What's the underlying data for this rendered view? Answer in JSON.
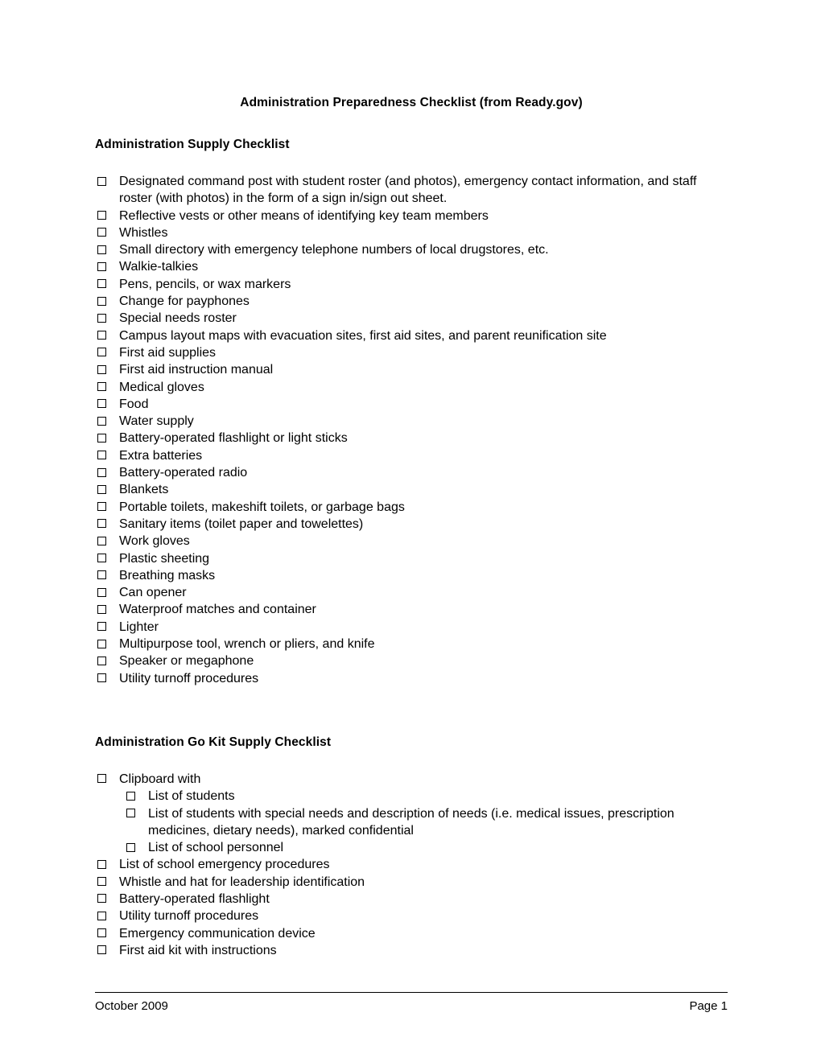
{
  "document": {
    "title": "Administration Preparedness Checklist (from Ready.gov)"
  },
  "sections": [
    {
      "heading": "Administration Supply Checklist",
      "items": [
        "Designated command post with student roster (and photos), emergency contact information, and staff roster (with photos) in the form of a sign in/sign out sheet.",
        "Reflective vests or other means of identifying key team members",
        "Whistles",
        "Small directory with emergency telephone numbers of local drugstores, etc.",
        "Walkie-talkies",
        "Pens, pencils, or wax markers",
        "Change for payphones",
        "Special needs roster",
        "Campus layout maps with evacuation sites, first aid sites, and parent reunification site",
        "First aid supplies",
        "First aid instruction manual",
        "Medical gloves",
        "Food",
        "Water supply",
        "Battery-operated flashlight or light sticks",
        "Extra batteries",
        "Battery-operated radio",
        "Blankets",
        "Portable toilets, makeshift toilets, or garbage bags",
        "Sanitary items (toilet paper and towelettes)",
        "Work gloves",
        "Plastic sheeting",
        "Breathing masks",
        "Can opener",
        "Waterproof matches and container",
        "Lighter",
        "Multipurpose tool, wrench or pliers, and knife",
        "Speaker or megaphone",
        "Utility turnoff procedures"
      ]
    },
    {
      "heading": "Administration Go Kit Supply Checklist",
      "items": [
        "Clipboard with",
        "List of students",
        "List of students with special needs and description of needs (i.e. medical issues, prescription medicines, dietary needs), marked confidential",
        "List of school personnel",
        "List of school emergency procedures",
        "Whistle and hat for leadership identification",
        "Battery-operated flashlight",
        "Utility turnoff procedures",
        "Emergency communication device",
        "First aid kit with instructions"
      ],
      "nested_indices": [
        1,
        2,
        3
      ]
    }
  ],
  "footer": {
    "date": "October 2009",
    "page": "Page 1"
  }
}
